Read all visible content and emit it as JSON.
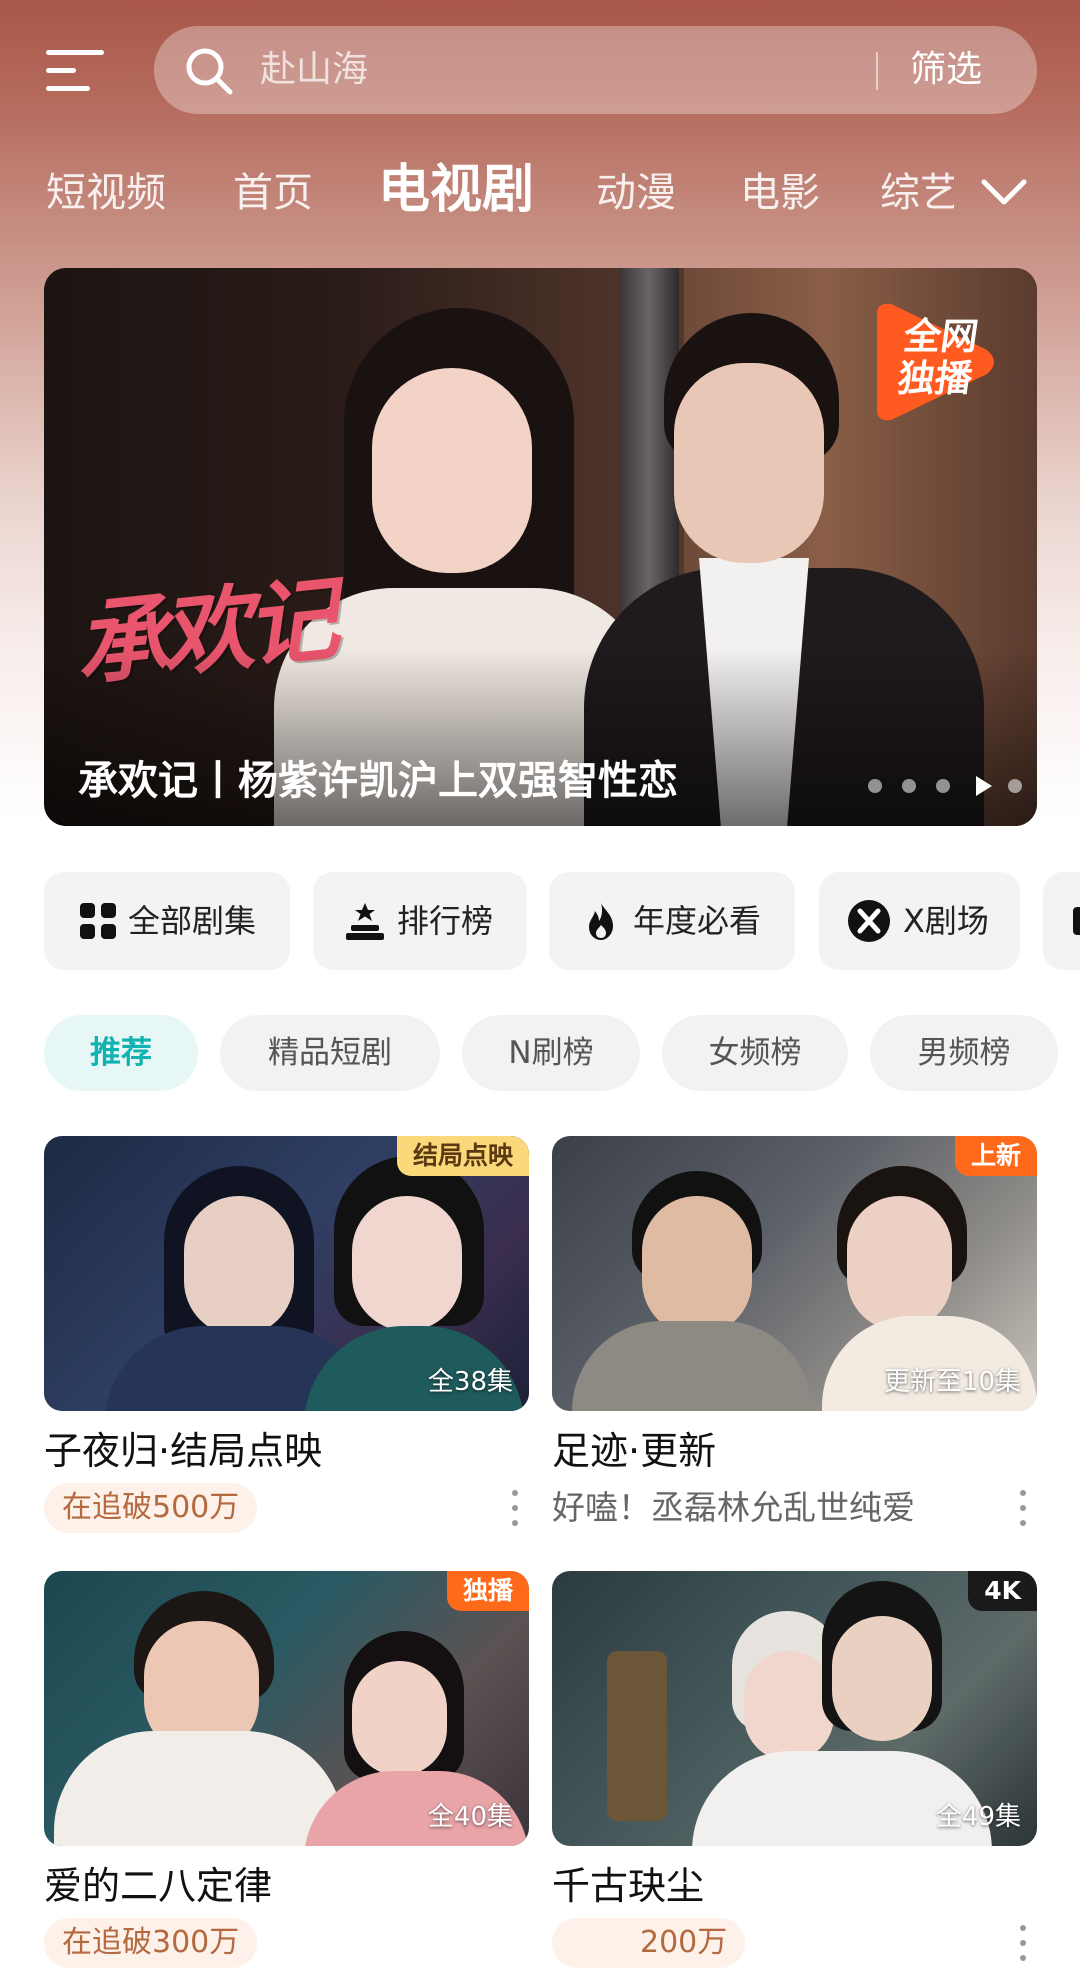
{
  "header": {
    "search_placeholder": "赴山海",
    "filter_label": "筛选"
  },
  "tabs": [
    {
      "label": "短视频"
    },
    {
      "label": "首页"
    },
    {
      "label": "电视剧",
      "active": true
    },
    {
      "label": "动漫"
    },
    {
      "label": "电影"
    },
    {
      "label": "综艺"
    }
  ],
  "banner": {
    "caption": "承欢记丨杨紫许凯沪上双强智性恋",
    "art_title": "承欢记",
    "badge": "全网独播",
    "page_count": 5,
    "current_page": 3
  },
  "quick_entries": [
    {
      "label": "全部剧集",
      "icon": "grid-icon"
    },
    {
      "label": "排行榜",
      "icon": "podium-icon"
    },
    {
      "label": "年度必看",
      "icon": "flame-icon"
    },
    {
      "label": "X剧场",
      "icon": "x-theater-icon"
    }
  ],
  "chips": [
    {
      "label": "推荐",
      "active": true
    },
    {
      "label": "精品短剧"
    },
    {
      "label": "N刷榜"
    },
    {
      "label": "女频榜"
    },
    {
      "label": "男频榜"
    }
  ],
  "cards": [
    {
      "title": "子夜归·结局点映",
      "tag": "结局点映",
      "tag_style": "gold",
      "episodes": "全38集",
      "meta": "在追破500万",
      "meta_type": "pill"
    },
    {
      "title": "足迹·更新",
      "tag": "上新",
      "tag_style": "orange",
      "episodes": "更新至10集",
      "meta": "好嗑！丞磊林允乱世纯爱",
      "meta_type": "text"
    },
    {
      "title": "爱的二八定律",
      "tag": "独播",
      "tag_style": "orange",
      "episodes": "全40集",
      "meta": "在追破300万",
      "meta_type": "pill"
    },
    {
      "title": "千古玦尘",
      "tag": "4K",
      "tag_style": "black",
      "episodes": "全49集",
      "meta": "200万",
      "meta_type": "pill"
    }
  ],
  "colors": {
    "accent": "#11b3b2",
    "tag_gold": "#fbd97a",
    "tag_orange": "#ff6a1a",
    "tag_black": "#1a1a1a"
  }
}
